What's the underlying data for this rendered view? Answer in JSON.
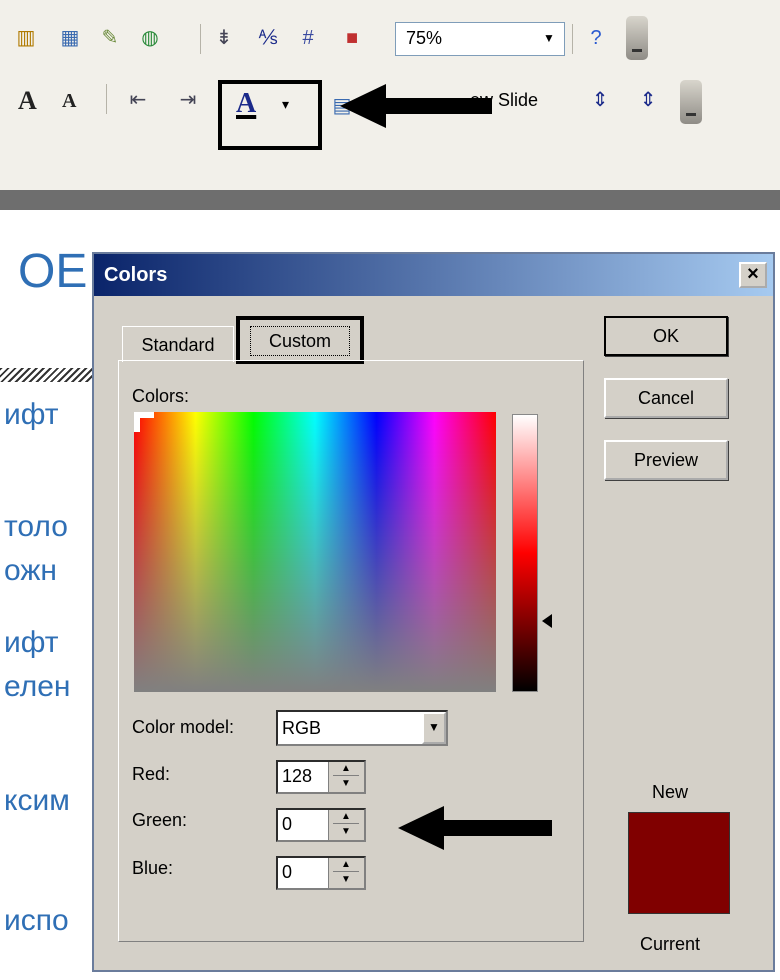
{
  "toolbar": {
    "zoom_value": "75%",
    "new_slide_label": "ew Slide",
    "font_color_glyph": "A",
    "bold_A_glyph": "A",
    "small_A_glyph": "A"
  },
  "slide": {
    "title_fragment": "OE",
    "lines": [
      "ифт",
      "толо",
      "ожн",
      "ифт",
      "елен",
      "ксим",
      "испо"
    ]
  },
  "dialog": {
    "title": "Colors",
    "close_glyph": "×",
    "tabs": [
      "Standard",
      "Custom"
    ],
    "colors_label": "Colors:",
    "color_model_label": "Color model:",
    "color_model_value": "RGB",
    "red_label": "Red:",
    "red_value": "128",
    "green_label": "Green:",
    "green_value": "0",
    "blue_label": "Blue:",
    "blue_value": "0",
    "ok_label": "OK",
    "cancel_label": "Cancel",
    "preview_label": "Preview",
    "new_label": "New",
    "current_label": "Current",
    "preview_color": "#800000"
  },
  "icons": {
    "toolbar_row1": [
      "chart-icon",
      "table-icon",
      "edit-icon",
      "globe-icon",
      "sort-icon",
      "fraction-icon",
      "grid-icon",
      "color-chart-icon",
      "help-icon"
    ],
    "toolbar_row2": [
      "grow-font-icon",
      "shrink-font-icon",
      "decrease-indent-icon",
      "increase-indent-icon",
      "font-color-icon",
      "design-icon",
      "new-slide-icon",
      "line-spacing-icon"
    ]
  }
}
